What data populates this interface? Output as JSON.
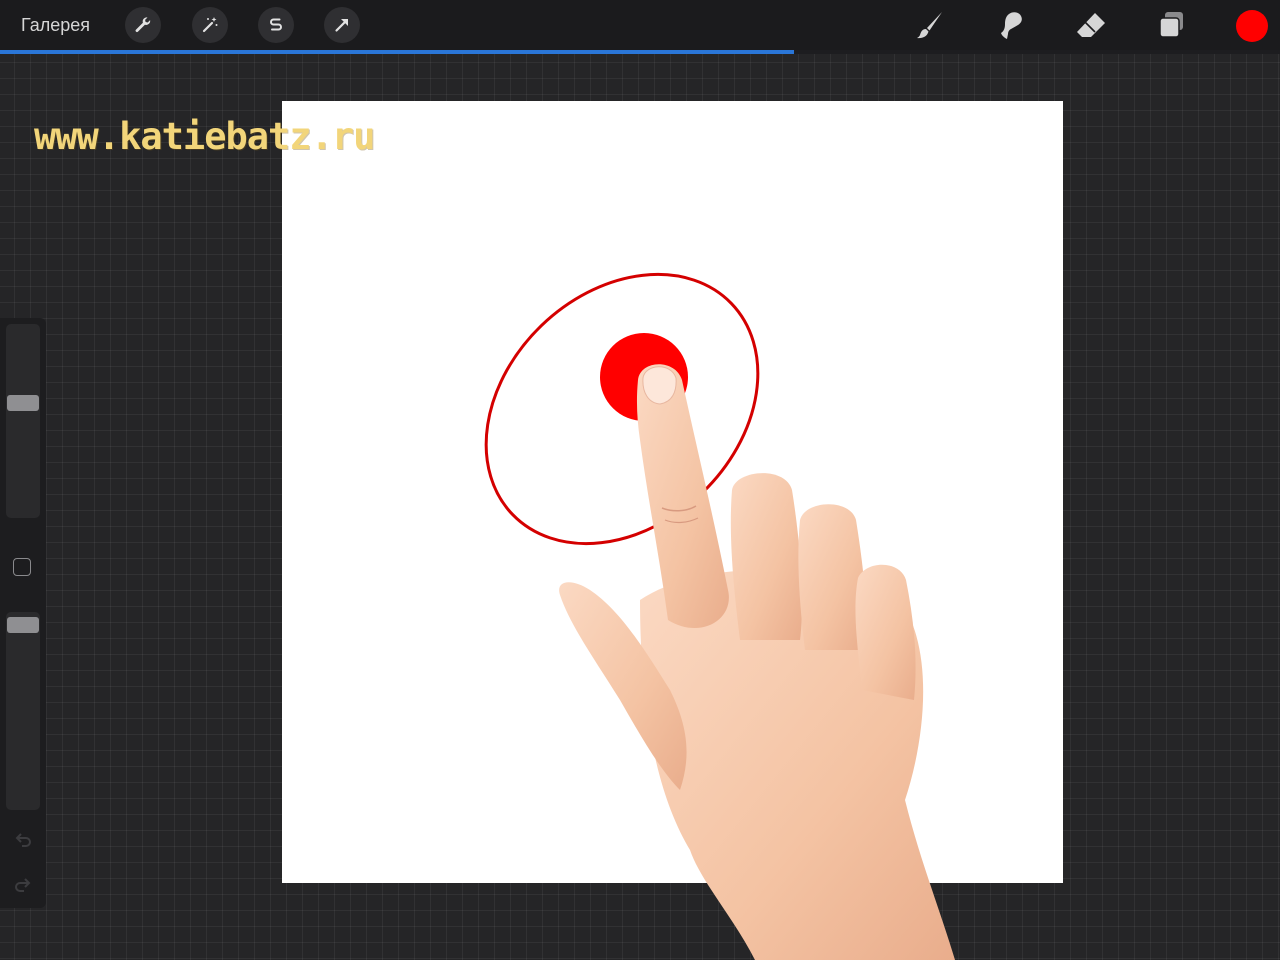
{
  "toolbar": {
    "gallery_label": "Галерея",
    "left_tools": [
      "wrench-icon",
      "magic-wand-icon",
      "selection-s-icon",
      "move-arrow-icon"
    ],
    "right_tools": [
      "brush-icon",
      "smudge-icon",
      "eraser-icon",
      "layers-icon"
    ],
    "current_color": "#ff0000"
  },
  "progress": {
    "fraction": 0.62,
    "color": "#2a76d8"
  },
  "watermark": {
    "text": "www.katiebatz.ru"
  },
  "sidebar": {
    "brush_size_level": 0.6,
    "opacity_level": 0.97,
    "icons": [
      "modify-square-icon",
      "undo-icon",
      "redo-icon"
    ]
  },
  "colors": {
    "accent": "#2a76d8",
    "stroke_red": "#d40000",
    "dot_red": "#ff0000"
  }
}
